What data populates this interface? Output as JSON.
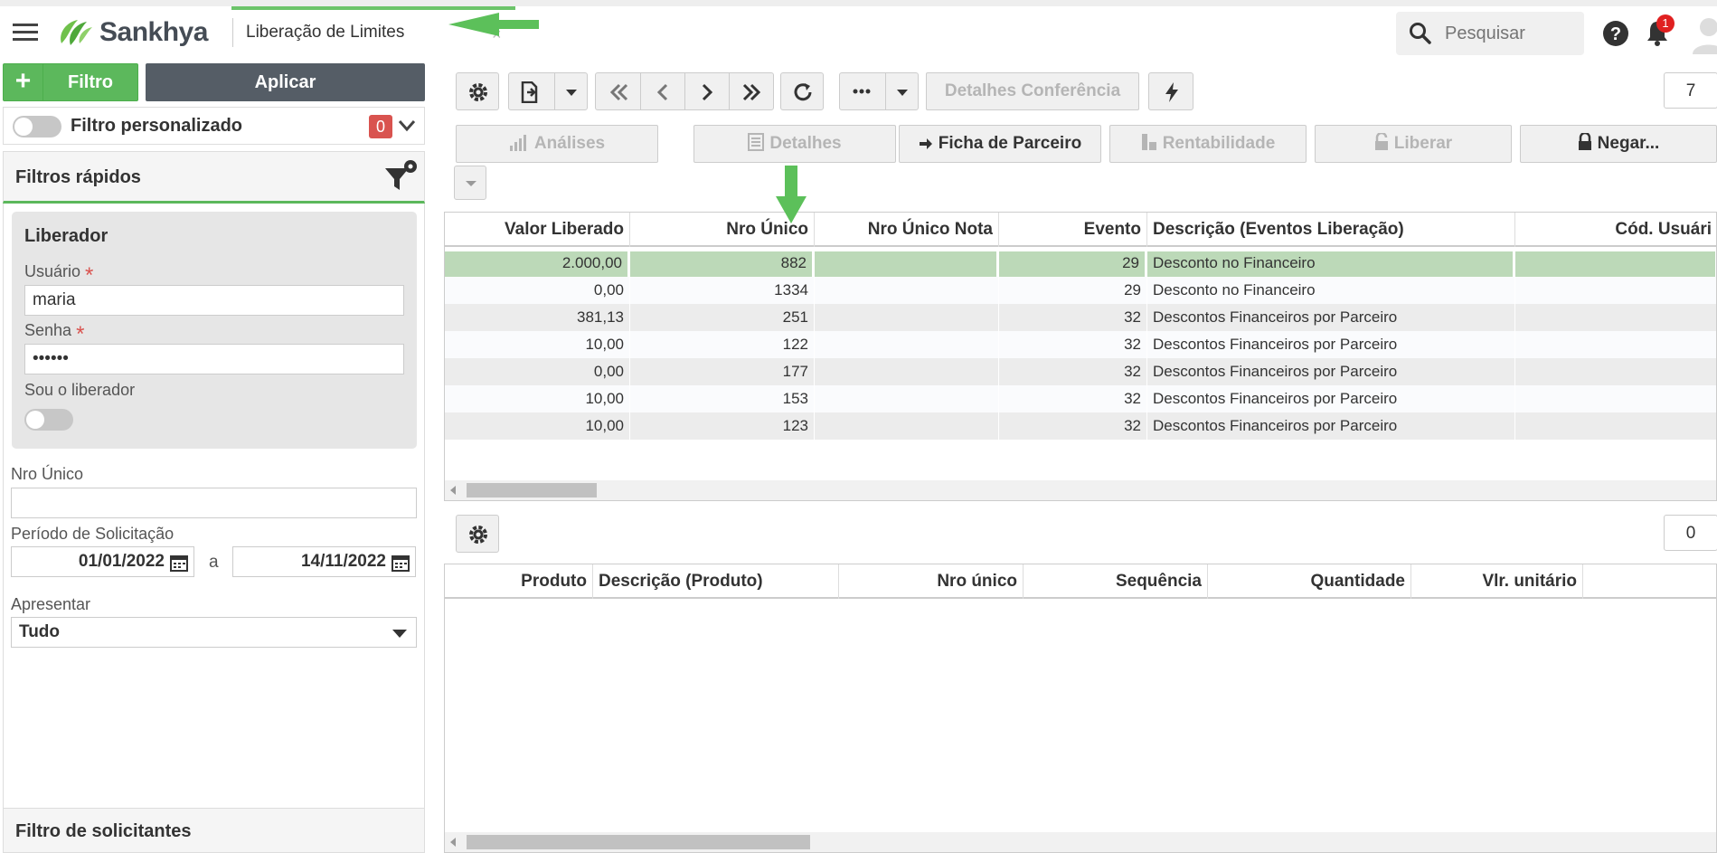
{
  "app": {
    "brand": "Sankhya",
    "page_title": "Liberação de Limites",
    "close_tab_glyph": "×",
    "search_placeholder": "Pesquisar",
    "notification_count": "1",
    "colors": {
      "brand_green": "#5cb85c",
      "selected_row": "#bcd9b8",
      "badge_red": "#d9534f"
    }
  },
  "left_panel": {
    "filtro_plus": "+",
    "filtro_label": "Filtro",
    "aplicar_label": "Aplicar",
    "filtro_personalizado_label": "Filtro personalizado",
    "filtro_personalizado_count": "0",
    "filtros_rapidos_title": "Filtros rápidos",
    "liberador": {
      "title": "Liberador",
      "usuario_label": "Usuário",
      "usuario_value": "maria",
      "senha_label": "Senha",
      "senha_value": "••••••",
      "required_mark": "*",
      "sou_liberador_label": "Sou o liberador"
    },
    "nro_unico_label": "Nro Único",
    "nro_unico_value": "",
    "periodo_label": "Período de Solicitação",
    "periodo_start": "01/01/2022",
    "periodo_sep": "a",
    "periodo_end": "14/11/2022",
    "apresentar_label": "Apresentar",
    "apresentar_value": "Tudo",
    "filtro_solicitantes": "Filtro de solicitantes"
  },
  "toolbar": {
    "detalhes_conferencia": "Detalhes Conferência",
    "record_count": "7",
    "analises": "Análises",
    "detalhes": "Detalhes",
    "ficha_parceiro": "Ficha de Parceiro",
    "rentabilidade": "Rentabilidade",
    "liberar": "Liberar",
    "negar": "Negar..."
  },
  "main_grid": {
    "columns": [
      "Valor Liberado",
      "Nro Único",
      "Nro Único Nota",
      "Evento",
      "Descrição (Eventos Liberação)",
      "Cód. Usuári"
    ],
    "rows": [
      {
        "valor": "2.000,00",
        "nro": "882",
        "nota": "",
        "evento": "29",
        "descricao": "Desconto no Financeiro",
        "cod": ""
      },
      {
        "valor": "0,00",
        "nro": "1334",
        "nota": "",
        "evento": "29",
        "descricao": "Desconto no Financeiro",
        "cod": ""
      },
      {
        "valor": "381,13",
        "nro": "251",
        "nota": "",
        "evento": "32",
        "descricao": "Descontos Financeiros por Parceiro",
        "cod": ""
      },
      {
        "valor": "10,00",
        "nro": "122",
        "nota": "",
        "evento": "32",
        "descricao": "Descontos Financeiros por Parceiro",
        "cod": ""
      },
      {
        "valor": "0,00",
        "nro": "177",
        "nota": "",
        "evento": "32",
        "descricao": "Descontos Financeiros por Parceiro",
        "cod": ""
      },
      {
        "valor": "10,00",
        "nro": "153",
        "nota": "",
        "evento": "32",
        "descricao": "Descontos Financeiros por Parceiro",
        "cod": ""
      },
      {
        "valor": "10,00",
        "nro": "123",
        "nota": "",
        "evento": "32",
        "descricao": "Descontos Financeiros por Parceiro",
        "cod": ""
      }
    ]
  },
  "detail_grid": {
    "record_count": "0",
    "columns": [
      "Produto",
      "Descrição (Produto)",
      "Nro único",
      "Sequência",
      "Quantidade",
      "Vlr. unitário"
    ]
  }
}
